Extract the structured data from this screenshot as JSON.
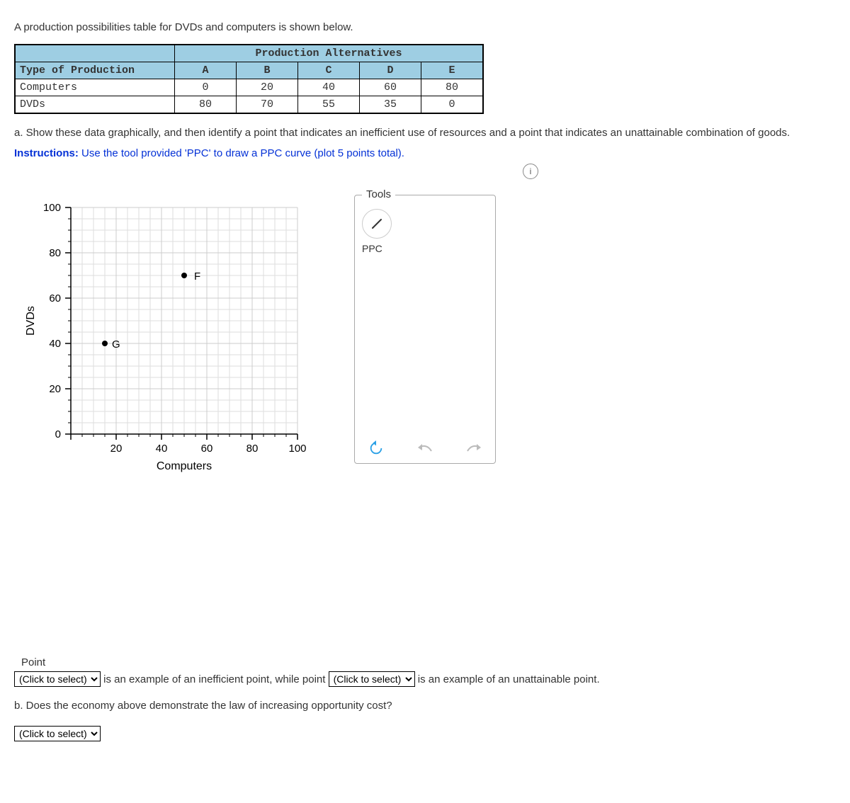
{
  "intro_text": "A production possibilities table for DVDs and computers is shown below.",
  "table": {
    "group_header": "Production Alternatives",
    "row_header_title": "Type of Production",
    "alternatives": [
      "A",
      "B",
      "C",
      "D",
      "E"
    ],
    "rows": [
      {
        "label": "Computers",
        "values": [
          "0",
          "20",
          "40",
          "60",
          "80"
        ]
      },
      {
        "label": "DVDs",
        "values": [
          "80",
          "70",
          "55",
          "35",
          "0"
        ]
      }
    ]
  },
  "part_a_text": "a. Show these data graphically, and then identify a point that indicates an inefficient use of resources and a point that indicates an unattainable combination of goods.",
  "instructions_label": "Instructions:",
  "instructions_text": " Use the tool provided 'PPC' to draw a PPC curve (plot 5 points total).",
  "info_icon": "i",
  "chart": {
    "x_label": "Computers",
    "y_label": "DVDs",
    "x_ticks": [
      "0",
      "20",
      "40",
      "60",
      "80",
      "100"
    ],
    "y_ticks": [
      "0",
      "20",
      "40",
      "60",
      "80",
      "100"
    ],
    "points": [
      {
        "name": "G",
        "x": 15,
        "y": 40
      },
      {
        "name": "F",
        "x": 50,
        "y": 70
      }
    ]
  },
  "tools": {
    "title": "Tools",
    "ppc_label": "PPC"
  },
  "answer": {
    "point_label": "Point",
    "select_placeholder": "(Click to select)",
    "sentence1_mid": " is an example of an inefficient point, while point ",
    "sentence1_end": " is an example of an unattainable point."
  },
  "part_b_text": "b. Does the economy above demonstrate the law of increasing opportunity cost?",
  "chart_data": {
    "type": "scatter",
    "title": "",
    "xlabel": "Computers",
    "ylabel": "DVDs",
    "xlim": [
      0,
      100
    ],
    "ylim": [
      0,
      100
    ],
    "grid": true,
    "series": [
      {
        "name": "points",
        "points": [
          {
            "label": "G",
            "x": 15,
            "y": 40
          },
          {
            "label": "F",
            "x": 50,
            "y": 70
          }
        ]
      }
    ]
  }
}
